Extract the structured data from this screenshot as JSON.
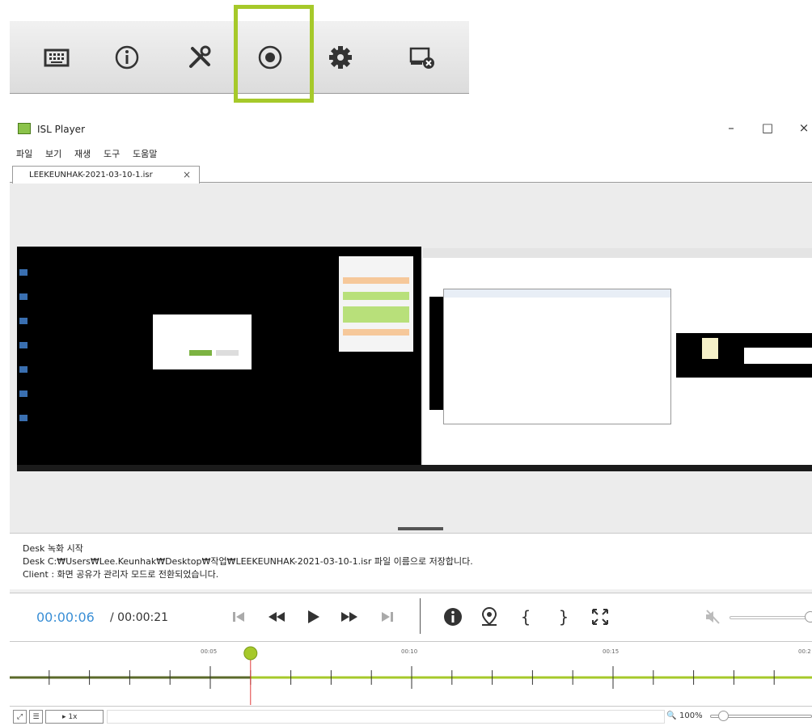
{
  "window": {
    "title": "ISL Player",
    "minimize": "–",
    "maximize": "□",
    "close": "×"
  },
  "menu": [
    "파일",
    "보기",
    "재생",
    "도구",
    "도움말"
  ],
  "tab": {
    "label": "LEEKEUNHAK-2021-03-10-1.isr",
    "close": "×"
  },
  "log": [
    "Desk 녹화 시작",
    "Desk C:₩Users₩Lee.Keunhak₩Desktop₩작업₩LEEKEUNHAK-2021-03-10-1.isr 파일 이름으로 저장합니다.",
    "Client : 화면 공유가 관리자 모드로 전환되었습니다."
  ],
  "player": {
    "current_time": "00:00:06",
    "total_time": "/ 00:00:21"
  },
  "timeline": {
    "tick_labels": [
      "00:05",
      "00:10",
      "00:15",
      "00:2"
    ],
    "progress_fraction": 0.2857
  },
  "statusbar": {
    "speed": "▸ 1x",
    "zoom": "100%"
  },
  "colors": {
    "accent_green": "#a6c92a",
    "time_blue": "#3a8fd6",
    "playhead_red": "#e23b3b"
  }
}
